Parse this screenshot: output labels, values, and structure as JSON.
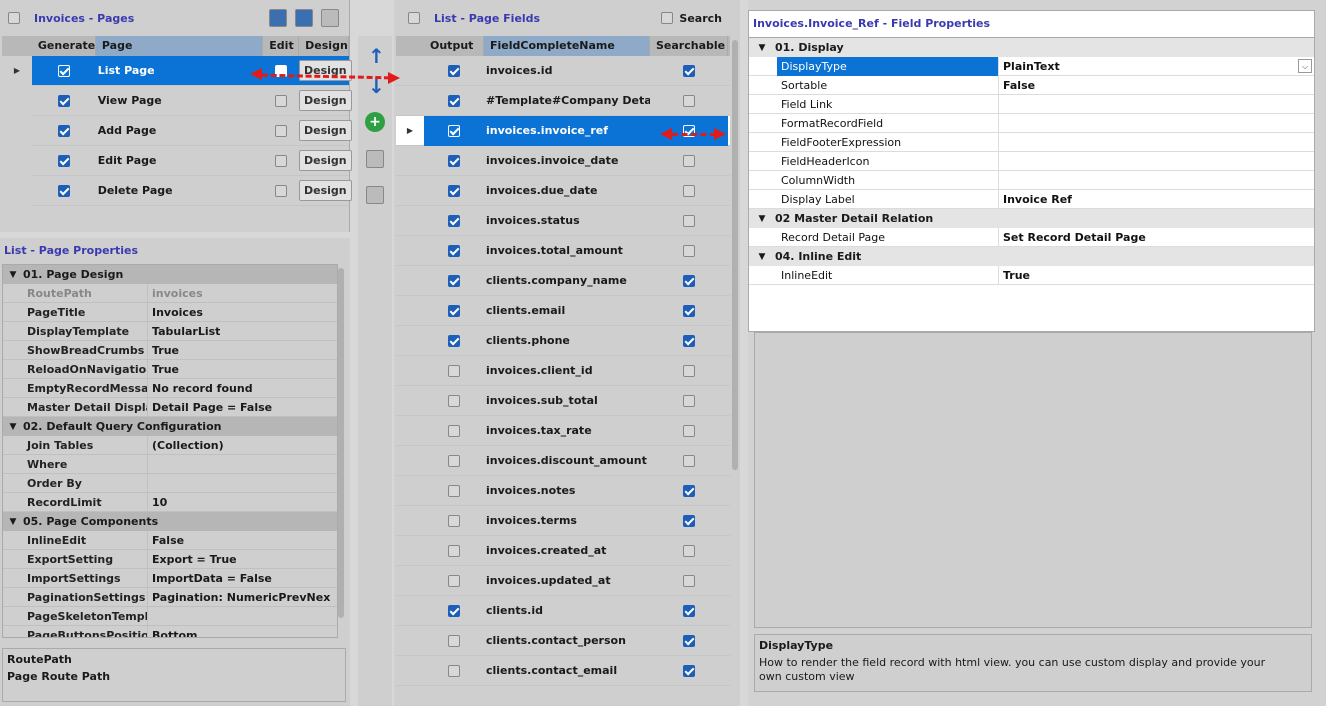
{
  "pages_panel": {
    "title": "Invoices - Pages",
    "columns": [
      "Generate",
      "Page",
      "Edit",
      "Design"
    ],
    "rows": [
      {
        "label": "List Page",
        "generate": true,
        "edit": false,
        "design": "Design"
      },
      {
        "label": "View Page",
        "generate": true,
        "edit": false,
        "design": "Design"
      },
      {
        "label": "Add Page",
        "generate": true,
        "edit": false,
        "design": "Design"
      },
      {
        "label": "Edit Page",
        "generate": true,
        "edit": false,
        "design": "Design"
      },
      {
        "label": "Delete Page",
        "generate": true,
        "edit": false,
        "design": "Design"
      }
    ]
  },
  "page_props": {
    "title": "List - Page Properties",
    "sections": [
      {
        "name": "01. Page Design",
        "rows": [
          {
            "k": "RoutePath",
            "v": "invoices"
          },
          {
            "k": "PageTitle",
            "v": "Invoices"
          },
          {
            "k": "DisplayTemplate",
            "v": "TabularList"
          },
          {
            "k": "ShowBreadCrumbs",
            "v": "True"
          },
          {
            "k": "ReloadOnNavigation",
            "v": "True"
          },
          {
            "k": "EmptyRecordMessage",
            "v": "No record found"
          },
          {
            "k": "Master Detail Display",
            "v": "Detail Page = False"
          }
        ]
      },
      {
        "name": "02. Default Query Configuration",
        "rows": [
          {
            "k": "Join Tables",
            "v": "(Collection)"
          },
          {
            "k": "Where",
            "v": ""
          },
          {
            "k": "Order By",
            "v": ""
          },
          {
            "k": "RecordLimit",
            "v": "10"
          }
        ]
      },
      {
        "name": "05. Page Components",
        "rows": [
          {
            "k": "InlineEdit",
            "v": "False"
          },
          {
            "k": "ExportSetting",
            "v": "Export = True"
          },
          {
            "k": "ImportSettings",
            "v": "ImportData = False"
          },
          {
            "k": "PaginationSettings",
            "v": "Pagination: NumericPrevNex"
          },
          {
            "k": "PageSkeletonTemplate",
            "v": ""
          },
          {
            "k": "PageButtonsPosition",
            "v": "Bottom"
          }
        ]
      }
    ],
    "help_title": "RoutePath",
    "help_text": "Page Route Path"
  },
  "fields_panel": {
    "title": "List - Page Fields",
    "search_label": "Search",
    "columns": [
      "Output",
      "FieldCompleteName",
      "Searchable"
    ],
    "rows": [
      {
        "name": "invoices.id",
        "output": true,
        "searchable": true
      },
      {
        "name": "#Template#Company Details",
        "output": true,
        "searchable": false
      },
      {
        "name": "invoices.invoice_ref",
        "output": true,
        "searchable": true
      },
      {
        "name": "invoices.invoice_date",
        "output": true,
        "searchable": false
      },
      {
        "name": "invoices.due_date",
        "output": true,
        "searchable": false
      },
      {
        "name": "invoices.status",
        "output": true,
        "searchable": false
      },
      {
        "name": "invoices.total_amount",
        "output": true,
        "searchable": false
      },
      {
        "name": "clients.company_name",
        "output": true,
        "searchable": true
      },
      {
        "name": "clients.email",
        "output": true,
        "searchable": true
      },
      {
        "name": "clients.phone",
        "output": true,
        "searchable": true
      },
      {
        "name": "invoices.client_id",
        "output": false,
        "searchable": false
      },
      {
        "name": "invoices.sub_total",
        "output": false,
        "searchable": false
      },
      {
        "name": "invoices.tax_rate",
        "output": false,
        "searchable": false
      },
      {
        "name": "invoices.discount_amount",
        "output": false,
        "searchable": false
      },
      {
        "name": "invoices.notes",
        "output": false,
        "searchable": true
      },
      {
        "name": "invoices.terms",
        "output": false,
        "searchable": true
      },
      {
        "name": "invoices.created_at",
        "output": false,
        "searchable": false
      },
      {
        "name": "invoices.updated_at",
        "output": false,
        "searchable": false
      },
      {
        "name": "clients.id",
        "output": true,
        "searchable": true
      },
      {
        "name": "clients.contact_person",
        "output": false,
        "searchable": true
      },
      {
        "name": "clients.contact_email",
        "output": false,
        "searchable": true
      }
    ]
  },
  "field_props": {
    "title": "Invoices.Invoice_Ref - Field Properties",
    "sections": [
      {
        "name": "01. Display",
        "rows": [
          {
            "k": "DisplayType",
            "v": "PlainText",
            "selected": true
          },
          {
            "k": "Sortable",
            "v": "False"
          },
          {
            "k": "Field Link",
            "v": ""
          },
          {
            "k": "FormatRecordField",
            "v": ""
          },
          {
            "k": "FieldFooterExpression",
            "v": ""
          },
          {
            "k": "FieldHeaderIcon",
            "v": ""
          },
          {
            "k": "ColumnWidth",
            "v": ""
          },
          {
            "k": "Display Label",
            "v": "Invoice Ref"
          }
        ]
      },
      {
        "name": "02 Master Detail Relation",
        "rows": [
          {
            "k": "Record Detail Page",
            "v": "Set Record Detail Page"
          }
        ]
      },
      {
        "name": "04. Inline Edit",
        "rows": [
          {
            "k": "InlineEdit",
            "v": "True"
          }
        ]
      }
    ],
    "help_title": "DisplayType",
    "help_text": "How to render the field record with html view. you can use custom display and provide your own custom view"
  },
  "colors": {
    "selection": "#0b73d6",
    "accent_title": "#3a3ab0",
    "arrow": "#e01b1b"
  }
}
